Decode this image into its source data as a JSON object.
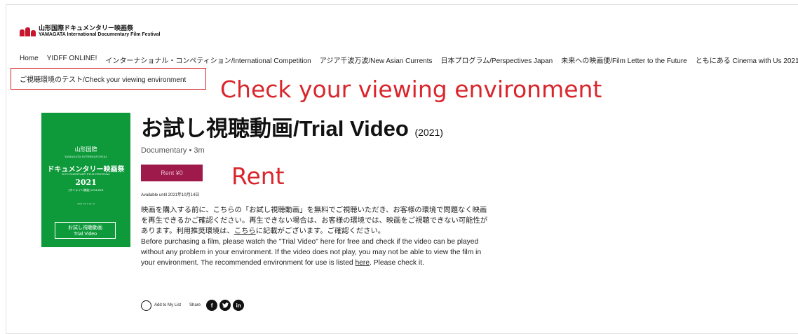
{
  "logo": {
    "jp_text": "山形国際ドキュメンタリー映画祭",
    "en_text": "YAMAGATA International Documentary Film Festival"
  },
  "nav": {
    "items": [
      "Home",
      "YIDFF ONLINE!",
      "インターナショナル・コンペティション/International Competition",
      "アジア千波万波/New Asian Currents",
      "日本プログラム/Perspectives Japan",
      "未来への映画便/Film Letter to the Future",
      "ともにある Cinema with Us 2021"
    ]
  },
  "sub_nav": {
    "label": "ご視聴環境のテスト/Check your viewing environment"
  },
  "annotations": {
    "check": "Check your viewing environment",
    "rent": "Rent"
  },
  "poster": {
    "line1": "山形国際",
    "line2": "YAMAGATA INTERNATIONAL",
    "line3": "ドキュメンタリー映画祭",
    "line4": "DOCUMENTARY FILM FESTIVAL",
    "year": "2021",
    "tag": "[オンライン開催] ONLINE",
    "dates": "2021.10.7-10.14",
    "box_jp": "お試し視聴動画",
    "box_en": "Trial Video"
  },
  "film": {
    "title": "お試し視聴動画/Trial Video",
    "year": "(2021)",
    "meta": "Documentary • 3m",
    "rent_label": "Rent ¥0",
    "available": "Available until 2021年10月14日"
  },
  "description": {
    "jp_before": "映画を購入する前に、こちらの「お試し視聴動画」を無料でご視聴いただき、お客様の環境で問題なく映画を再生できるかご確認ください。再生できない場合は、お客様の環境では、映画をご視聴できない可能性があります。利用推奨環境は、",
    "jp_link": "こちら",
    "jp_after": "に記載がございます。ご確認ください。",
    "en_before": "Before purchasing a film, please watch the \"Trial Video\" here for free and check if the video can be played without any problem in your environment. If the video does not play, you may not be able to view the film in your environment. The recommended environment for use is listed ",
    "en_link": "here",
    "en_after": ". Please check it."
  },
  "actions": {
    "add_to_list": "Add to My List",
    "share": "Share",
    "icons": [
      "facebook-icon",
      "twitter-icon",
      "linkedin-icon"
    ]
  },
  "colors": {
    "accent_red": "#d9262c",
    "rent_button": "#9e1a4a",
    "poster_green": "#0e9a3a"
  }
}
